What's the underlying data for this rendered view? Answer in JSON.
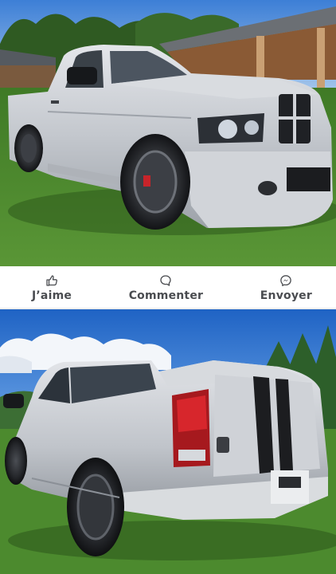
{
  "colors": {
    "action_text": "#4a4c50",
    "background": "#ffffff",
    "sky_top": "#2f6fc9",
    "truck_silver": "#c9ccd1",
    "grass": "#4f8a2f",
    "stripe": "#1c1d20"
  },
  "post": {
    "photos": [
      {
        "description_name": "silver-pickup-front-three-quarter-photo"
      },
      {
        "description_name": "silver-pickup-rear-three-quarter-photo"
      }
    ],
    "actions": [
      {
        "label": "J’aime",
        "icon": "thumbs-up-icon"
      },
      {
        "label": "Commenter",
        "icon": "comment-bubble-icon"
      },
      {
        "label": "Envoyer",
        "icon": "messenger-icon"
      }
    ]
  }
}
